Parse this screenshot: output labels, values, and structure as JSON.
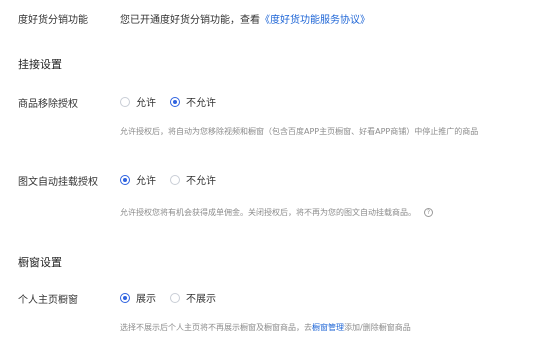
{
  "distribution": {
    "label": "度好货分销功能",
    "text_prefix": "您已开通度好货分销功能，查看",
    "agreement_link": "《度好货功能服务协议》"
  },
  "mount_section": {
    "title": "挂接设置",
    "product_removal": {
      "label": "商品移除授权",
      "options": [
        "允许",
        "不允许"
      ],
      "selected": "不允许",
      "hint": "允许授权后，将自动为您移除视频和橱窗（包含百度APP主页橱窗、好看APP商铺）中停止推广的商品"
    },
    "auto_mount": {
      "label": "图文自动挂载授权",
      "options": [
        "允许",
        "不允许"
      ],
      "selected": "允许",
      "hint": "允许授权您将有机会获得成单佣金。关闭授权后，将不再为您的图文自动挂载商品。",
      "help_icon": "question-circle-icon"
    }
  },
  "window_section": {
    "title": "橱窗设置",
    "personal_window": {
      "label": "个人主页橱窗",
      "options": [
        "展示",
        "不展示"
      ],
      "selected": "展示",
      "hint_prefix": "选择不展示后个人主页将不再展示橱窗及橱窗商品，去",
      "hint_link": "橱窗管理",
      "hint_suffix": "添加/删除橱窗商品"
    }
  },
  "colors": {
    "accent": "#2f63e0",
    "link": "#1f66d6",
    "hint": "#8c8c8c"
  }
}
